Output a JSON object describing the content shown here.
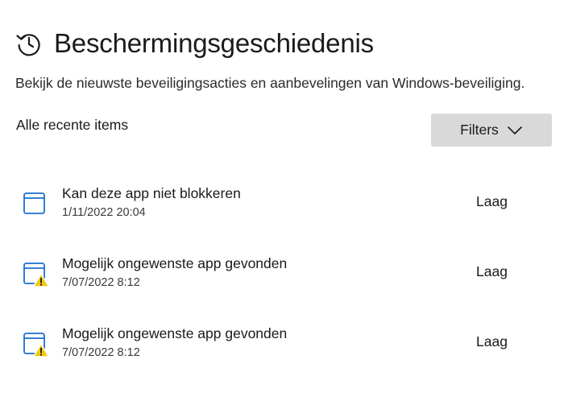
{
  "page": {
    "title": "Beschermingsgeschiedenis",
    "title_icon": "history-clock-icon",
    "subtitle": "Bekijk de nieuwste beveiligingsacties en aanbevelingen van Windows-beveiliging."
  },
  "section": {
    "label": "Alle recente items"
  },
  "filters": {
    "label": "Filters",
    "icon": "chevron-down-icon"
  },
  "colors": {
    "icon_blue": "#1a6fd0",
    "warning_yellow": "#f2c811",
    "button_bg": "#d9d9d9"
  },
  "items": [
    {
      "title": "Kan deze app niet blokkeren",
      "date": "1/11/2022 20:04",
      "severity": "Laag",
      "icon": "app-window-icon"
    },
    {
      "title": "Mogelijk ongewenste app gevonden",
      "date": "7/07/2022 8:12",
      "severity": "Laag",
      "icon": "app-window-warning-icon"
    },
    {
      "title": "Mogelijk ongewenste app gevonden",
      "date": "7/07/2022 8:12",
      "severity": "Laag",
      "icon": "app-window-warning-icon"
    }
  ]
}
